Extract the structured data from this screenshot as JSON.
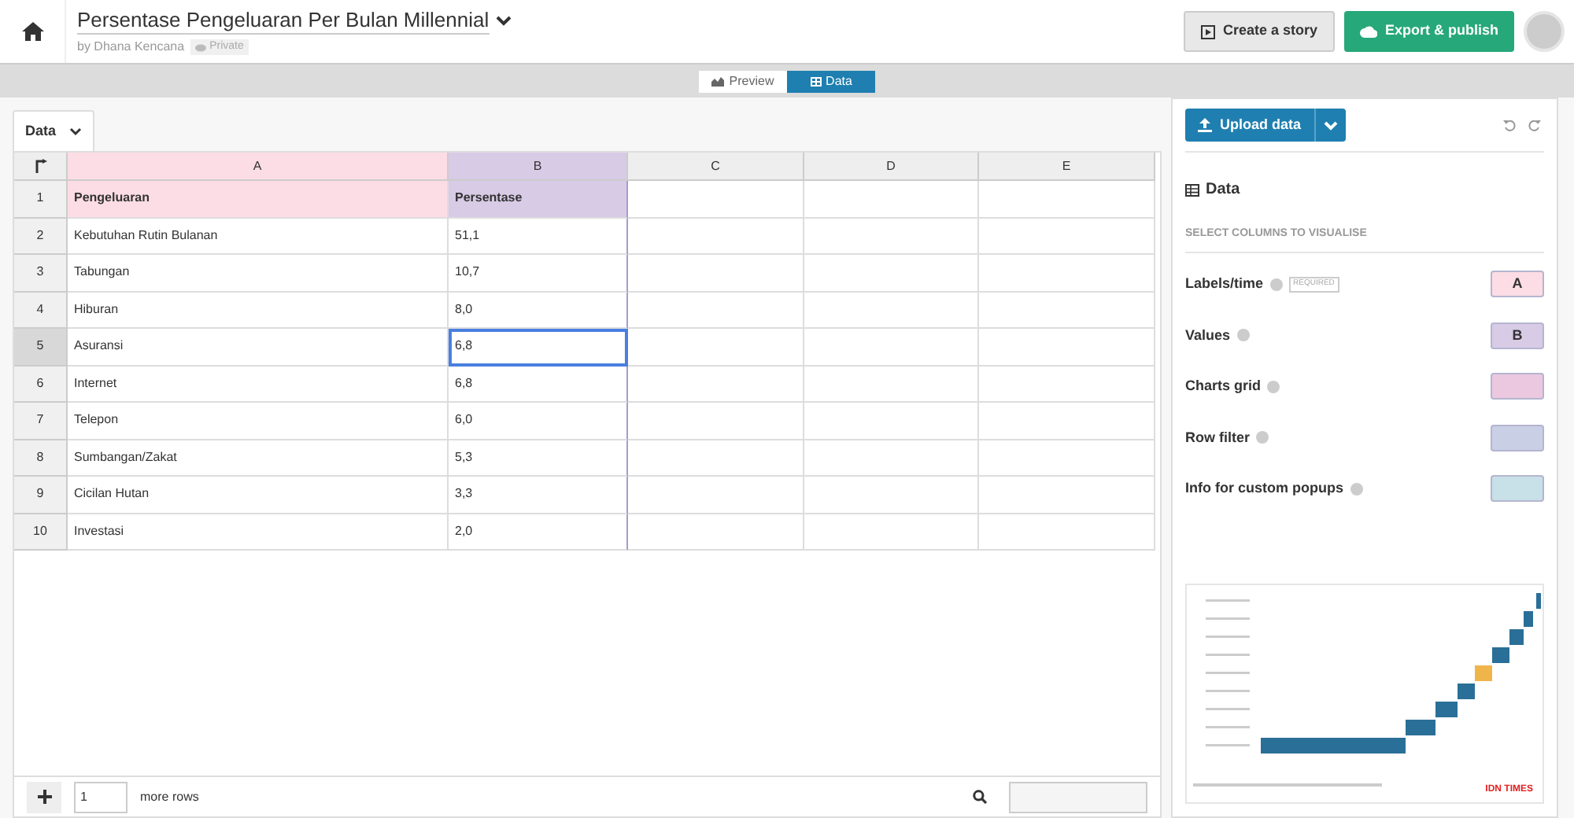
{
  "header": {
    "title": "Persentase Pengeluaran Per Bulan Millennial",
    "byline": "by Dhana Kencana",
    "privacy": "Private",
    "buttons": [
      {
        "kind": "story",
        "label": "Create a story"
      },
      {
        "kind": "publish",
        "label": "Export & publish"
      }
    ]
  },
  "view_toggle": [
    {
      "label": "Preview",
      "selected": false
    },
    {
      "label": "Data",
      "selected": true
    }
  ],
  "sheet_tab": {
    "label": "Data"
  },
  "table": {
    "columns": [
      {
        "label": "A",
        "color": "#fcdde5"
      },
      {
        "label": "B",
        "color": "#d8cbe6"
      },
      {
        "label": "C"
      },
      {
        "label": "D"
      },
      {
        "label": "E"
      }
    ],
    "rows": [
      {
        "number": "1",
        "selected": false,
        "header": true,
        "cells": [
          "Pengeluaran",
          "Persentase"
        ]
      },
      {
        "number": "2",
        "selected": false,
        "header": false,
        "cells": [
          "Kebutuhan Rutin Bulanan",
          "51,1"
        ]
      },
      {
        "number": "3",
        "selected": false,
        "header": false,
        "cells": [
          "Tabungan",
          "10,7"
        ]
      },
      {
        "number": "4",
        "selected": false,
        "header": false,
        "cells": [
          "Hiburan",
          "8,0"
        ]
      },
      {
        "number": "5",
        "selected": true,
        "header": false,
        "cells": [
          "Asuransi",
          "6,8"
        ]
      },
      {
        "number": "6",
        "selected": false,
        "header": false,
        "cells": [
          "Internet",
          "6,8"
        ]
      },
      {
        "number": "7",
        "selected": false,
        "header": false,
        "cells": [
          "Telepon",
          "6,0"
        ]
      },
      {
        "number": "8",
        "selected": false,
        "header": false,
        "cells": [
          "Sumbangan/Zakat",
          "5,3"
        ]
      },
      {
        "number": "9",
        "selected": false,
        "header": false,
        "cells": [
          "Cicilan Hutan",
          "3,3"
        ]
      },
      {
        "number": "10",
        "selected": false,
        "header": false,
        "cells": [
          "Investasi",
          "2,0"
        ]
      }
    ]
  },
  "footer": {
    "rows_value": "1",
    "rows_label": "more rows"
  },
  "panel": {
    "upload_label": "Upload data",
    "section_title": "Data",
    "subtitle": "SELECT COLUMNS TO VISUALISE",
    "mappings": [
      {
        "label": "Labels/time",
        "badge": "REQUIRED",
        "column": "A",
        "color": "#fcdde5"
      },
      {
        "label": "Values",
        "column": "B",
        "color": "#d8cbe6"
      },
      {
        "label": "Charts grid",
        "color": "#ebc8e0"
      },
      {
        "label": "Row filter",
        "color": "#c9d0e6"
      },
      {
        "label": "Info for custom popups",
        "color": "#c8e0e8"
      }
    ],
    "preview": {
      "logo": "IDN TIMES"
    }
  }
}
